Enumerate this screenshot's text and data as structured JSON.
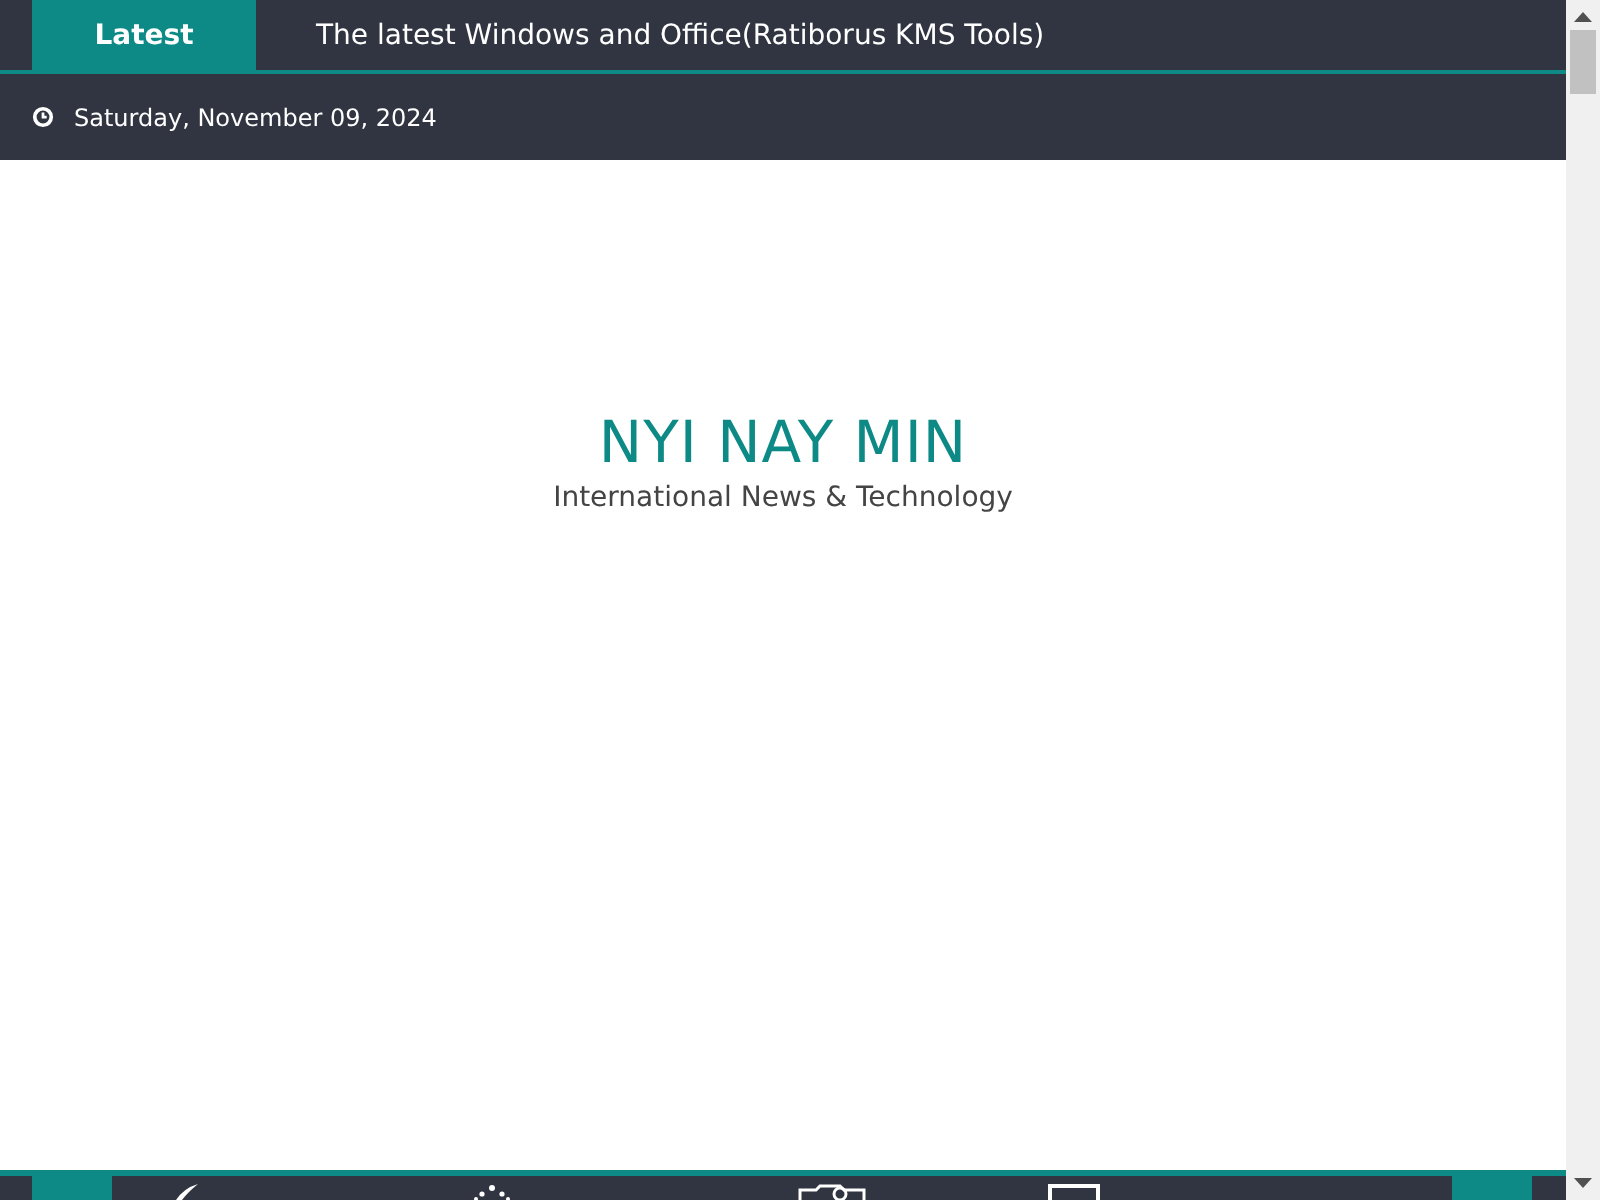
{
  "ticker": {
    "label": "Latest",
    "headline": "The latest Windows and Office(Ratiborus KMS Tools)"
  },
  "date_bar": {
    "date": "Saturday, November 09, 2024"
  },
  "header": {
    "site_title": "NYI NAY MIN",
    "tagline": "International News & Technology"
  }
}
